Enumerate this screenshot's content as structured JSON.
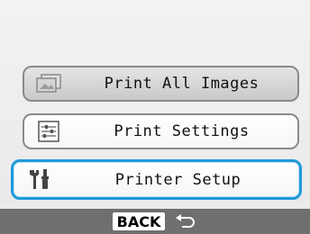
{
  "menu": {
    "items": [
      {
        "label": "Print All Images",
        "icon": "all-images-icon",
        "state": "disabled"
      },
      {
        "label": "Print Settings",
        "icon": "settings-icon",
        "state": "normal"
      },
      {
        "label": "Printer Setup",
        "icon": "tools-icon",
        "state": "selected"
      }
    ]
  },
  "footer": {
    "back_label": "BACK",
    "back_icon": "return-arrow-icon"
  },
  "colors": {
    "selection": "#1f9ad8",
    "footer_bg": "#6f6f6f"
  }
}
